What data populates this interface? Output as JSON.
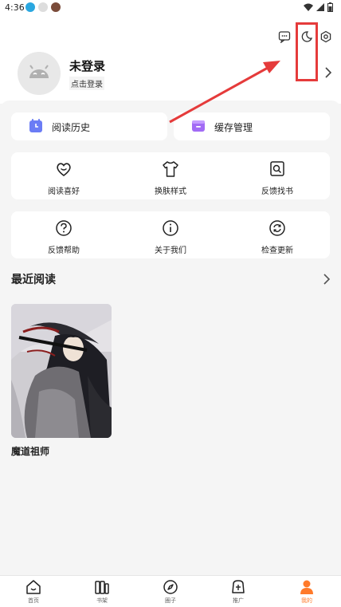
{
  "status_bar": {
    "time": "4:36",
    "battery_icon": "battery-icon",
    "wifi_icon": "wifi-icon",
    "signal_icon": "signal-icon"
  },
  "header": {
    "icons": [
      "message-icon",
      "moon-icon",
      "settings-icon"
    ],
    "username": "未登录",
    "login_hint": "点击登录",
    "chevron_icon": "chevron-right-icon"
  },
  "quick_links": [
    {
      "label": "阅读历史",
      "icon": "history-icon",
      "color": "#6b7cf5"
    },
    {
      "label": "缓存管理",
      "icon": "cache-icon",
      "color": "#a26bf5"
    }
  ],
  "grid_row_1": [
    {
      "label": "阅读喜好",
      "icon": "heart-smile-icon"
    },
    {
      "label": "换肤样式",
      "icon": "shirt-icon"
    },
    {
      "label": "反馈找书",
      "icon": "search-book-icon"
    }
  ],
  "grid_row_2": [
    {
      "label": "反馈帮助",
      "icon": "help-icon"
    },
    {
      "label": "关于我们",
      "icon": "info-icon"
    },
    {
      "label": "检查更新",
      "icon": "refresh-icon"
    }
  ],
  "recent": {
    "title": "最近阅读",
    "books": [
      {
        "title": "魔道祖师"
      }
    ]
  },
  "tabbar": [
    {
      "label": "首页",
      "icon": "home-icon",
      "active": false
    },
    {
      "label": "书架",
      "icon": "bookshelf-icon",
      "active": false
    },
    {
      "label": "圈子",
      "icon": "compass-icon",
      "active": false
    },
    {
      "label": "推广",
      "icon": "promo-icon",
      "active": false
    },
    {
      "label": "我的",
      "icon": "user-icon",
      "active": true
    }
  ],
  "colors": {
    "accent": "#ff7a2a",
    "annotation": "#e53b3b"
  }
}
